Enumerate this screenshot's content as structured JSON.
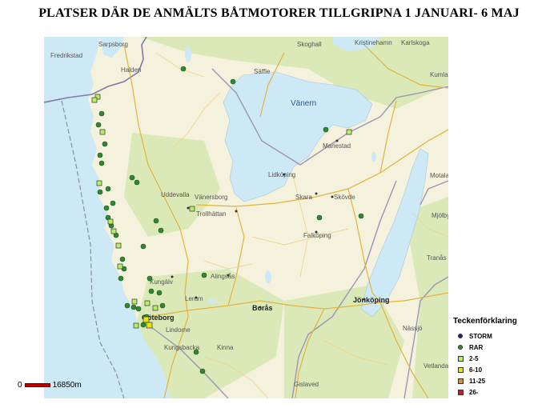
{
  "title": "PLATSER DÄR DE ANMÄLTS BÅTMOTORER TILLGRIPNA 1 JANUARI- 6 MAJ",
  "map": {
    "water_color": "#cde9f5",
    "land_color": "#f4f1dc",
    "forest_color": "#dbe9b8",
    "places": [
      {
        "name": "Fredrikstad",
        "style": "normal"
      },
      {
        "name": "Sarpsborg",
        "style": "normal"
      },
      {
        "name": "Halden",
        "style": "normal"
      },
      {
        "name": "Säffle",
        "style": "normal"
      },
      {
        "name": "Skoghall",
        "style": "normal"
      },
      {
        "name": "Kristinehamn",
        "style": "normal"
      },
      {
        "name": "Karlskoga",
        "style": "normal"
      },
      {
        "name": "Kumla",
        "style": "normal"
      },
      {
        "name": "Vänern",
        "style": "water"
      },
      {
        "name": "Mariestad",
        "style": "normal"
      },
      {
        "name": "Lidköping",
        "style": "normal"
      },
      {
        "name": "Uddevalla",
        "style": "normal"
      },
      {
        "name": "Vänersborg",
        "style": "normal"
      },
      {
        "name": "Trollhättan",
        "style": "normal"
      },
      {
        "name": "Skara",
        "style": "normal"
      },
      {
        "name": "Skövde",
        "style": "normal"
      },
      {
        "name": "Falköping",
        "style": "normal"
      },
      {
        "name": "Kungälv",
        "style": "normal"
      },
      {
        "name": "Alingsås",
        "style": "normal"
      },
      {
        "name": "Lerum",
        "style": "normal"
      },
      {
        "name": "Borås",
        "style": "bold"
      },
      {
        "name": "Jönköping",
        "style": "bold"
      },
      {
        "name": "Göteborg",
        "style": "bold"
      },
      {
        "name": "Lindome",
        "style": "normal"
      },
      {
        "name": "Kungsbacka",
        "style": "normal"
      },
      {
        "name": "Kinna",
        "style": "normal"
      },
      {
        "name": "Gislaved",
        "style": "normal"
      },
      {
        "name": "Nässjö",
        "style": "normal"
      },
      {
        "name": "Vetlanda",
        "style": "normal"
      },
      {
        "name": "Tranås",
        "style": "normal"
      },
      {
        "name": "Mjölby",
        "style": "normal"
      },
      {
        "name": "Motala",
        "style": "normal"
      }
    ]
  },
  "legend": {
    "title": "Teckenförklaring",
    "items": [
      {
        "label": "STORM",
        "shape": "dot",
        "color": "#1a1aa6"
      },
      {
        "label": "RAR",
        "shape": "dot",
        "color": "#2f8a2f"
      },
      {
        "label": "2-5",
        "shape": "square",
        "color": "#b4f062"
      },
      {
        "label": "6-10",
        "shape": "square",
        "color": "#e6e600"
      },
      {
        "label": "11-25",
        "shape": "square",
        "color": "#e08a30"
      },
      {
        "label": "26-",
        "shape": "square",
        "color": "#c82020"
      }
    ]
  },
  "scale": {
    "start": "0",
    "end": "16850m"
  }
}
